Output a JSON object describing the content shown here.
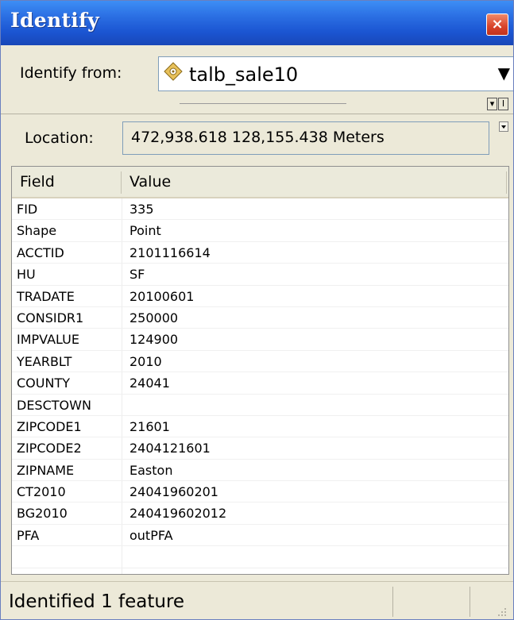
{
  "window": {
    "title": "Identify",
    "close_glyph": "×"
  },
  "identify_from": {
    "label": "Identify from:",
    "value": "talb_sale10",
    "icon": "point-layer-icon"
  },
  "toolbar": {
    "buttons": [
      "▾",
      "I"
    ]
  },
  "location": {
    "label": "Location:",
    "value": "472,938.618  128,155.438 Meters"
  },
  "table": {
    "headers": {
      "field": "Field",
      "value": "Value"
    },
    "rows": [
      {
        "field": "FID",
        "value": "335"
      },
      {
        "field": "Shape",
        "value": "Point"
      },
      {
        "field": "ACCTID",
        "value": "2101116614"
      },
      {
        "field": "HU",
        "value": "SF"
      },
      {
        "field": "TRADATE",
        "value": "20100601"
      },
      {
        "field": "CONSIDR1",
        "value": "250000"
      },
      {
        "field": "IMPVALUE",
        "value": "124900"
      },
      {
        "field": "YEARBLT",
        "value": "2010"
      },
      {
        "field": "COUNTY",
        "value": "24041"
      },
      {
        "field": "DESCTOWN",
        "value": ""
      },
      {
        "field": "ZIPCODE1",
        "value": "21601"
      },
      {
        "field": "ZIPCODE2",
        "value": "2404121601"
      },
      {
        "field": "ZIPNAME",
        "value": "Easton"
      },
      {
        "field": "CT2010",
        "value": "24041960201"
      },
      {
        "field": "BG2010",
        "value": "240419602012"
      },
      {
        "field": "PFA",
        "value": "outPFA"
      },
      {
        "field": "",
        "value": ""
      }
    ]
  },
  "status": {
    "text": "Identified 1 feature"
  },
  "colors": {
    "titlebar": "#2b6fe3",
    "close": "#d8432a",
    "panel": "#ece9d8"
  }
}
